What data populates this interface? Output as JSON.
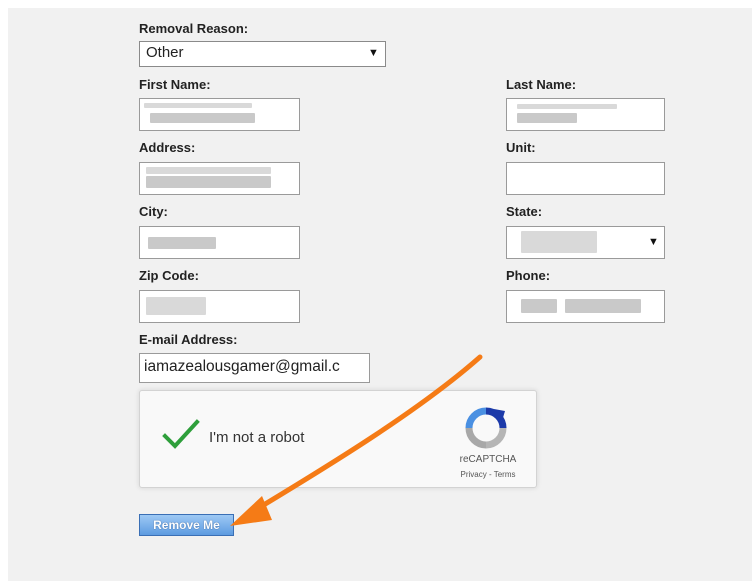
{
  "form": {
    "removal_reason_label": "Removal Reason:",
    "removal_reason_value": "Other",
    "first_name_label": "First Name:",
    "last_name_label": "Last Name:",
    "address_label": "Address:",
    "unit_label": "Unit:",
    "city_label": "City:",
    "state_label": "State:",
    "zip_label": "Zip Code:",
    "phone_label": "Phone:",
    "email_label": "E-mail Address:",
    "email_value": "iamazealousgamer@gmail.c"
  },
  "recaptcha": {
    "checkbox_label": "I'm not a robot",
    "brand": "reCAPTCHA",
    "links": "Privacy - Terms",
    "checked": true
  },
  "actions": {
    "remove_label": "Remove Me"
  },
  "colors": {
    "panel_bg": "#f1f1f1",
    "checkmark": "#2e9f3b",
    "arrow": "#f57b16",
    "button_border": "#3a6fb5"
  }
}
